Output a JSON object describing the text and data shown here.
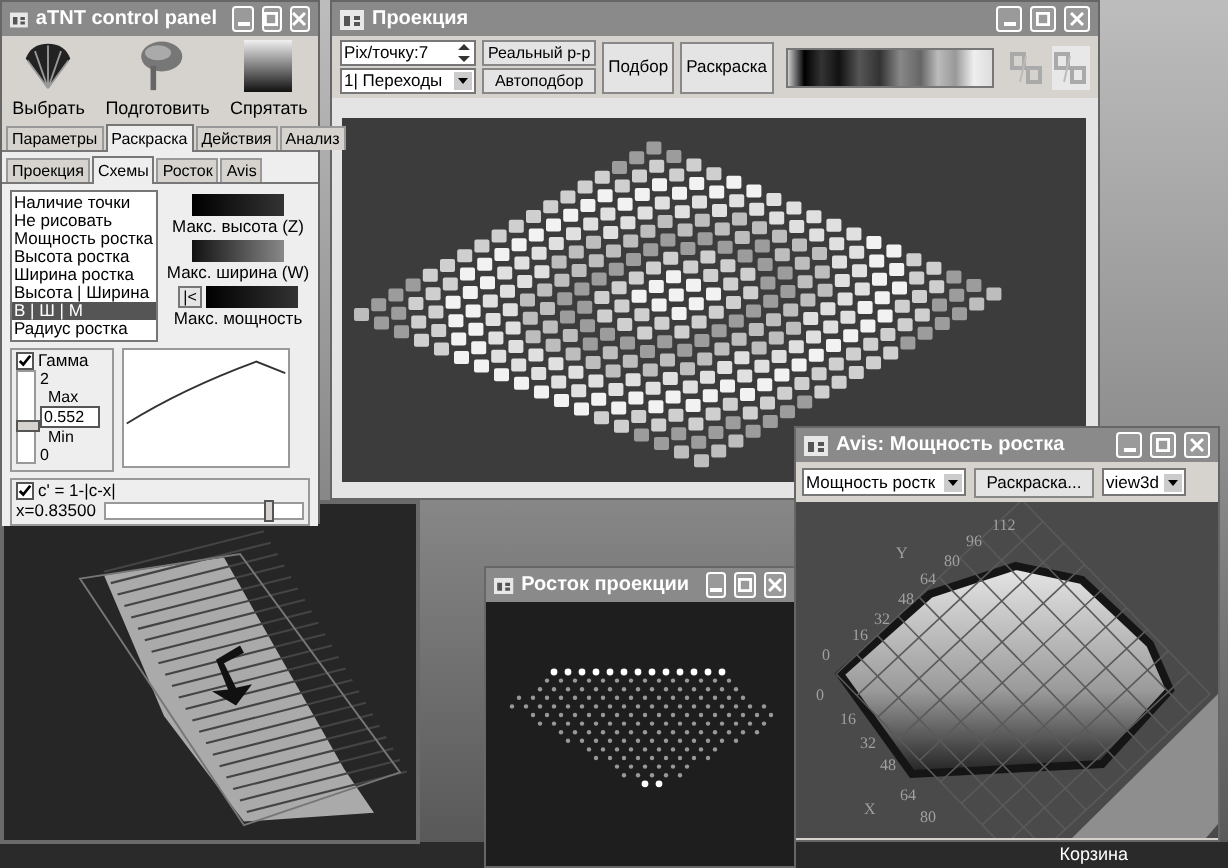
{
  "control_panel": {
    "title": "aTNT control panel",
    "tools": [
      {
        "kind": "shell",
        "label": "Выбрать"
      },
      {
        "kind": "pin",
        "label": "Подготовить"
      },
      {
        "kind": "gradient",
        "label": "Спрятать"
      }
    ],
    "tabs": [
      {
        "label": "Параметры",
        "selected": false
      },
      {
        "label": "Раскраска",
        "selected": true
      },
      {
        "label": "Действия",
        "selected": false
      },
      {
        "label": "Анализ",
        "selected": false
      }
    ],
    "subtabs": [
      {
        "label": "Проекция",
        "selected": false
      },
      {
        "label": "Схемы",
        "selected": true
      },
      {
        "label": "Росток",
        "selected": false
      },
      {
        "label": "Avis",
        "selected": false
      }
    ],
    "schemes": [
      {
        "label": "Наличие точки",
        "selected": false
      },
      {
        "label": "Не рисовать",
        "selected": false
      },
      {
        "label": "Мощность ростка",
        "selected": false
      },
      {
        "label": "Высота ростка",
        "selected": false
      },
      {
        "label": "Ширина ростка",
        "selected": false
      },
      {
        "label": "Высота | Ширина",
        "selected": false
      },
      {
        "label": "В | Ш | М",
        "selected": true
      },
      {
        "label": "Радиус ростка",
        "selected": false
      }
    ],
    "gradients": [
      {
        "label": "Макс. высота (Z)"
      },
      {
        "label": "Макс. ширина (W)"
      },
      {
        "label": "Макс. мощность"
      }
    ],
    "reset_button": "|<",
    "gamma": {
      "label": "Гамма",
      "checked": true,
      "max_value": "2",
      "max_label": "Max",
      "value": "0.552",
      "min_label": "Min",
      "min_value": "0",
      "level": 0.4
    },
    "formula": {
      "label": "c' = 1-|c-x|",
      "checked": true,
      "reading": "x=0.83500",
      "level": 0.84
    }
  },
  "projection": {
    "title": "Проекция",
    "pix_label": "Pix/точку:",
    "pix_value": "7",
    "mode": "1| Переходы",
    "buttons": [
      "Реальный р-р",
      "Автоподбор",
      "Подбор",
      "Раскраска"
    ]
  },
  "avis": {
    "title": "Avis: Мощность ростка",
    "measure": "Мощность ростк",
    "button": "Раскраска...",
    "view": "view3d",
    "y_label": "Y",
    "x_label": "X",
    "y_ticks": [
      "112",
      "96",
      "80",
      "64",
      "48",
      "32",
      "16",
      "0"
    ],
    "x_ticks": [
      "0",
      "16",
      "32",
      "48",
      "64",
      "80"
    ]
  },
  "rostok": {
    "title": "Росток проекции"
  },
  "desktop_icons": [
    {
      "label": "Корзина"
    }
  ]
}
